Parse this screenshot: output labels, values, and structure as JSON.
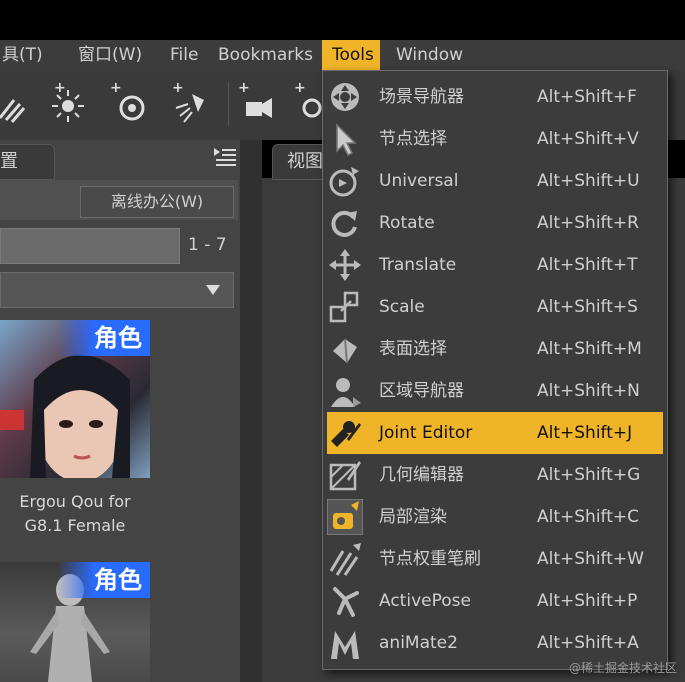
{
  "menubar": {
    "items": [
      "具(T)",
      "窗口(W)",
      "File",
      "Bookmarks",
      "Tools",
      "Window"
    ],
    "active": "Tools"
  },
  "left_panel": {
    "tab_label": "置",
    "offline_button": "离线办公(W)",
    "page_range": "1 - 7",
    "cards": [
      {
        "badge": "角色",
        "caption_line1": "Ergou Qou for",
        "caption_line2": "G8.1 Female"
      },
      {
        "badge": "角色"
      }
    ]
  },
  "view_tab": {
    "label": "视图"
  },
  "tools_menu": {
    "items": [
      {
        "label": "场景导航器",
        "shortcut": "Alt+Shift+F",
        "icon": "scene-navigator-icon"
      },
      {
        "label": "节点选择",
        "shortcut": "Alt+Shift+V",
        "icon": "node-select-icon"
      },
      {
        "label": "Universal",
        "shortcut": "Alt+Shift+U",
        "icon": "universal-icon"
      },
      {
        "label": "Rotate",
        "shortcut": "Alt+Shift+R",
        "icon": "rotate-icon"
      },
      {
        "label": "Translate",
        "shortcut": "Alt+Shift+T",
        "icon": "translate-icon"
      },
      {
        "label": "Scale",
        "shortcut": "Alt+Shift+S",
        "icon": "scale-icon"
      },
      {
        "label": "表面选择",
        "shortcut": "Alt+Shift+M",
        "icon": "surface-select-icon"
      },
      {
        "label": "区域导航器",
        "shortcut": "Alt+Shift+N",
        "icon": "region-navigator-icon"
      },
      {
        "label": "Joint Editor",
        "shortcut": "Alt+Shift+J",
        "icon": "joint-editor-icon",
        "highlighted": true
      },
      {
        "label": "几何编辑器",
        "shortcut": "Alt+Shift+G",
        "icon": "geometry-editor-icon"
      },
      {
        "label": "局部渲染",
        "shortcut": "Alt+Shift+C",
        "icon": "spot-render-icon"
      },
      {
        "label": "节点权重笔刷",
        "shortcut": "Alt+Shift+W",
        "icon": "node-weight-brush-icon"
      },
      {
        "label": "ActivePose",
        "shortcut": "Alt+Shift+P",
        "icon": "activepose-icon"
      },
      {
        "label": "aniMate2",
        "shortcut": "Alt+Shift+A",
        "icon": "animate2-icon"
      }
    ]
  },
  "watermark": "@稀土掘金技术社区",
  "colors": {
    "highlight": "#f0b429",
    "menu_bg": "#3c3c3c",
    "badge_blue": "#2a6bff"
  }
}
